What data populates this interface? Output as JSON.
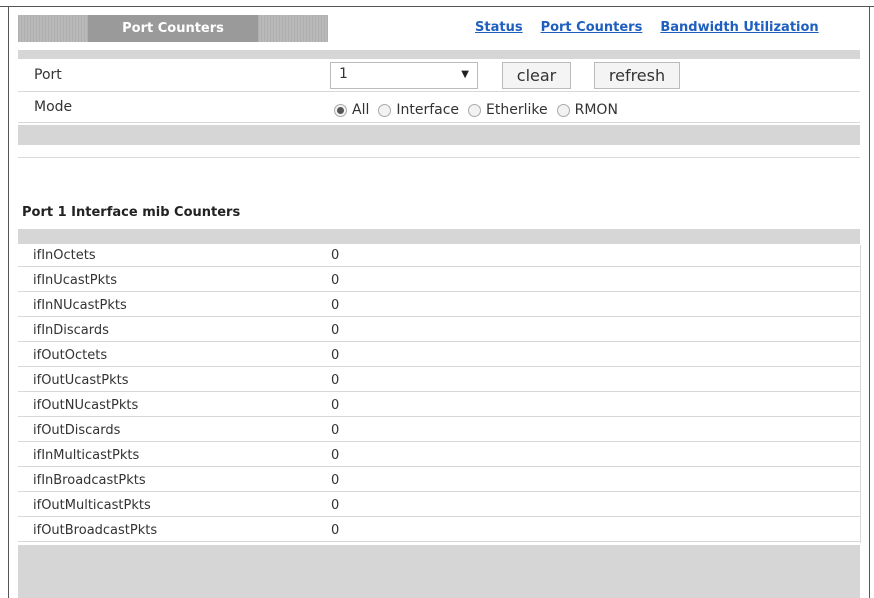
{
  "header": {
    "title": "Port Counters",
    "links": [
      "Status",
      "Port Counters",
      "Bandwidth Utilization"
    ]
  },
  "form": {
    "port_label": "Port",
    "port_value": "1",
    "clear_label": "clear",
    "refresh_label": "refresh",
    "mode_label": "Mode",
    "mode_options": [
      "All",
      "Interface",
      "Etherlike",
      "RMON"
    ],
    "mode_selected": "All"
  },
  "section": {
    "title": "Port 1 Interface mib Counters"
  },
  "counters": [
    {
      "name": "ifInOctets",
      "value": "0"
    },
    {
      "name": "ifInUcastPkts",
      "value": "0"
    },
    {
      "name": "ifInNUcastPkts",
      "value": "0"
    },
    {
      "name": "ifInDiscards",
      "value": "0"
    },
    {
      "name": "ifOutOctets",
      "value": "0"
    },
    {
      "name": "ifOutUcastPkts",
      "value": "0"
    },
    {
      "name": "ifOutNUcastPkts",
      "value": "0"
    },
    {
      "name": "ifOutDiscards",
      "value": "0"
    },
    {
      "name": "ifInMulticastPkts",
      "value": "0"
    },
    {
      "name": "ifInBroadcastPkts",
      "value": "0"
    },
    {
      "name": "ifOutMulticastPkts",
      "value": "0"
    },
    {
      "name": "ifOutBroadcastPkts",
      "value": "0"
    }
  ]
}
